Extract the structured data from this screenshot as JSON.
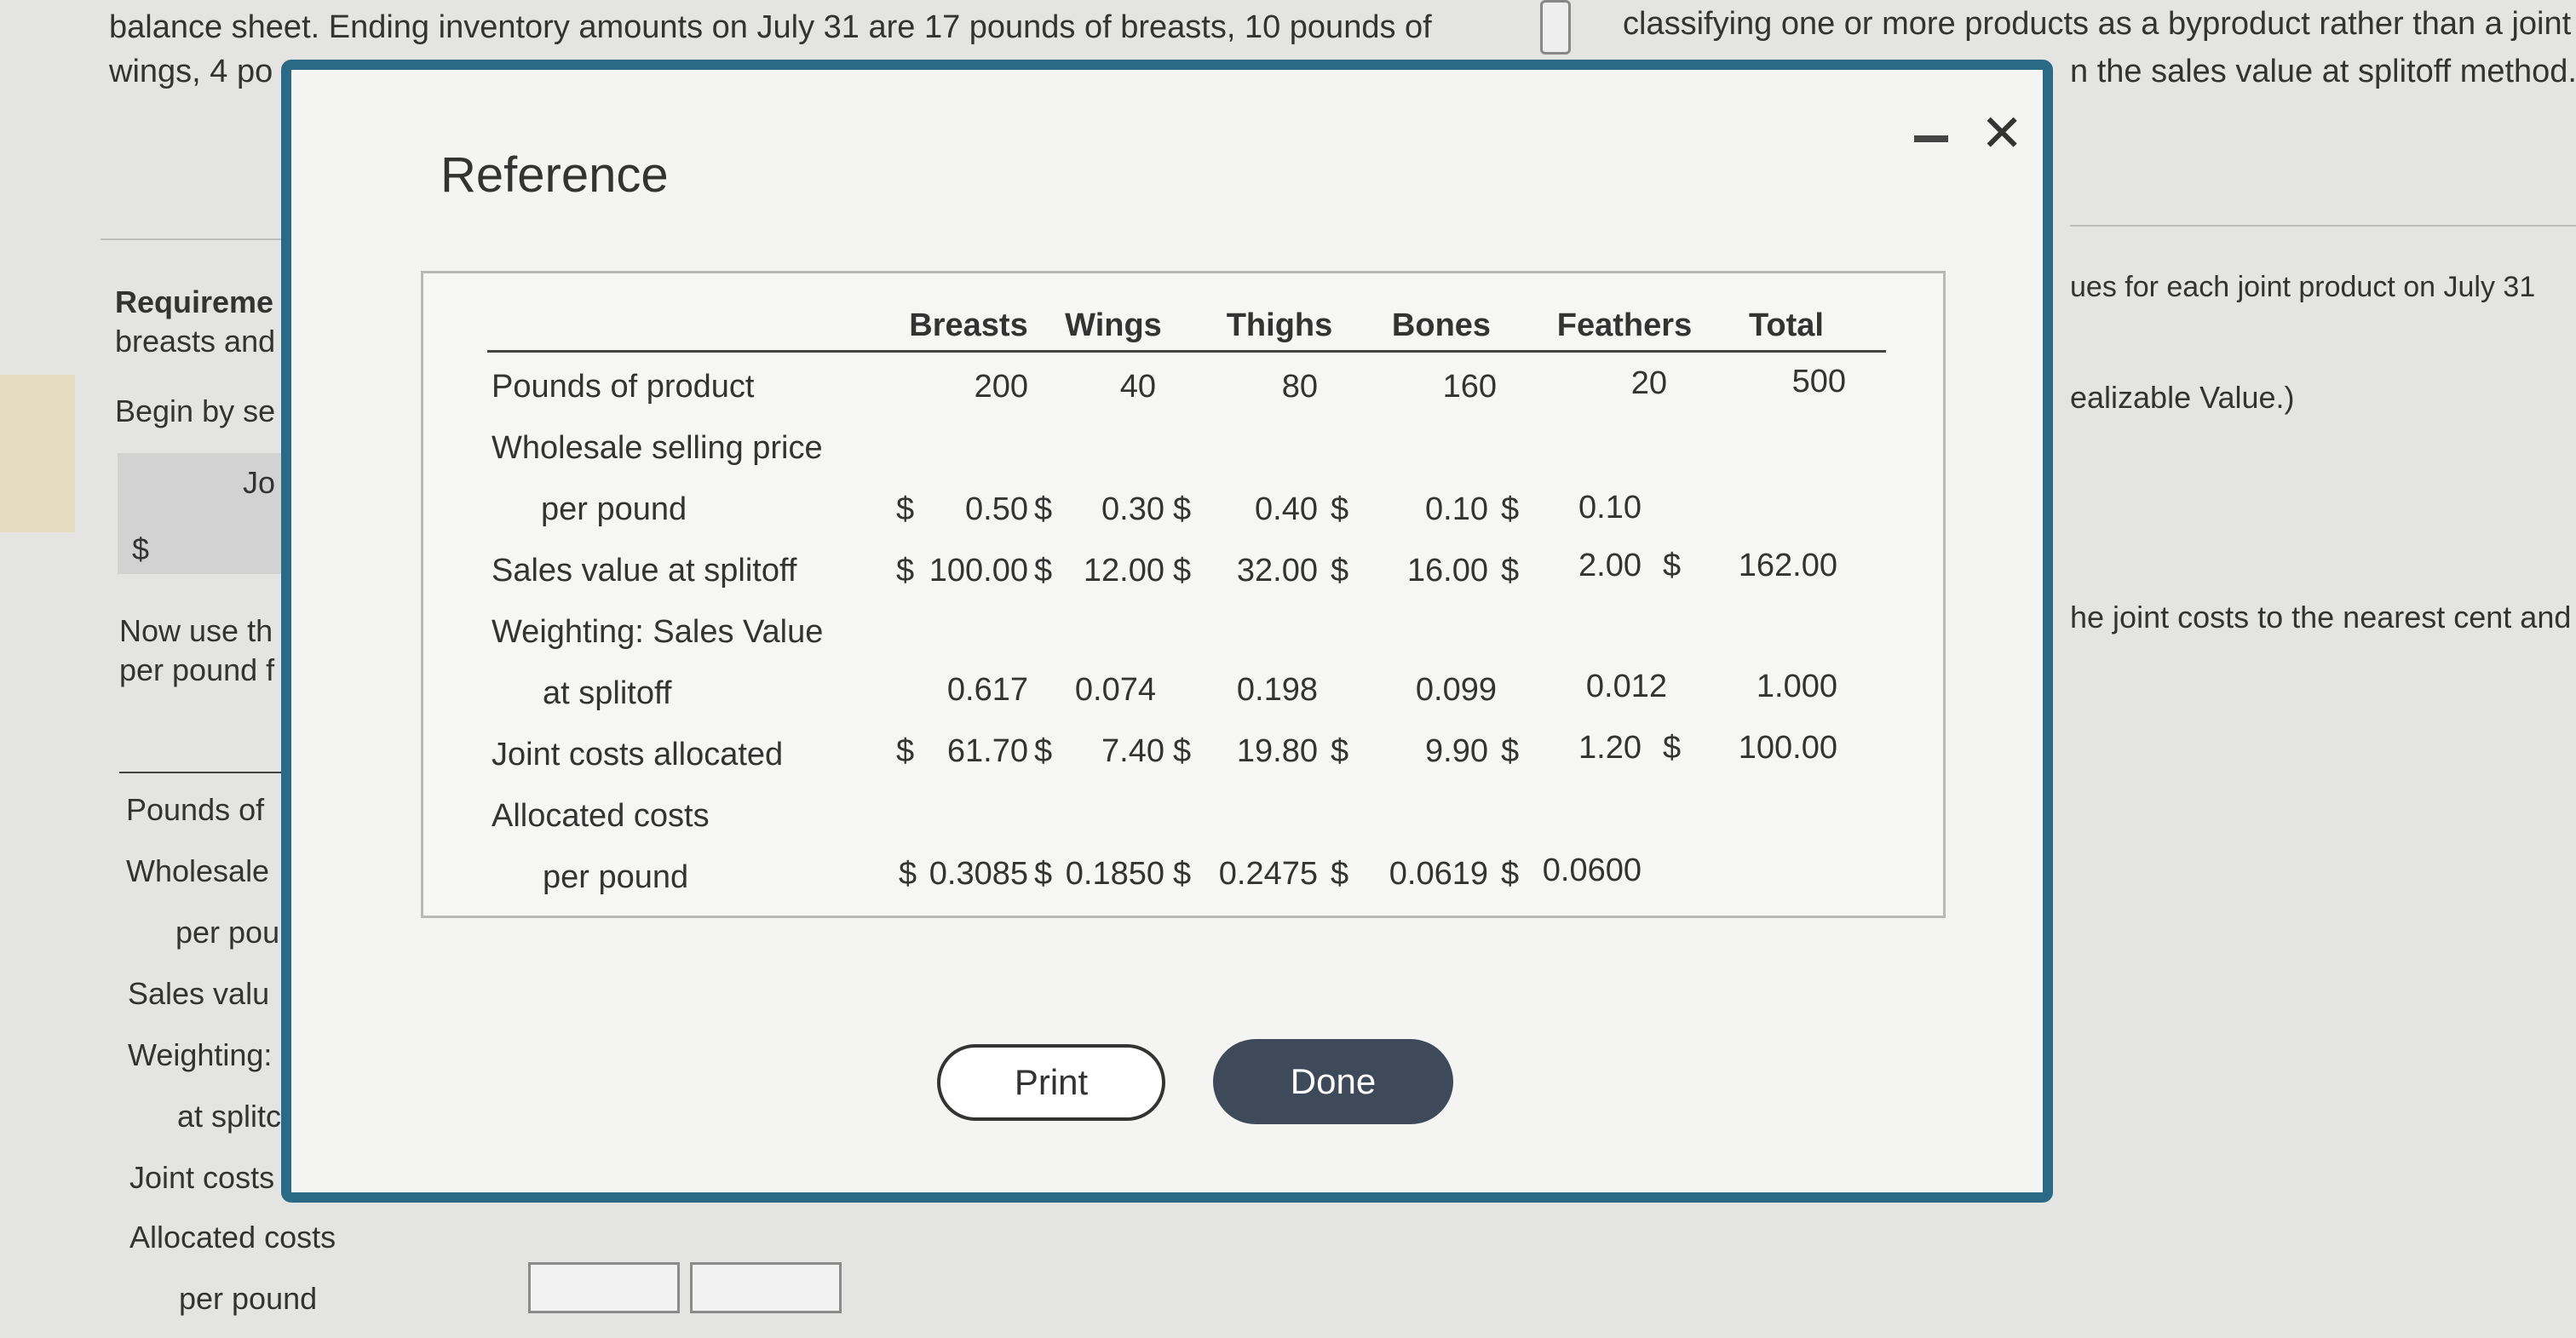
{
  "background": {
    "top_line1": "balance sheet. Ending inventory amounts on July 31 are 17 pounds of breasts, 10 pounds of",
    "top_line2": "wings, 4 po",
    "right_line1": "classifying one or more products as a byproduct rather than a joint pr",
    "right_line2": "n the sales value at splitoff method.)",
    "left_req1": "Requireme",
    "left_req2": "breasts and",
    "left_begin": "Begin by se",
    "left_jo": "Jo",
    "left_dollar": "$",
    "left_nowuse1": "Now use th",
    "left_nowuse2": "per pound f",
    "left_rows": [
      "Pounds of",
      "Wholesale",
      "per pou",
      "Sales valu",
      "Weighting:",
      "at splitc",
      "Joint costs",
      "Allocated costs",
      "per pound"
    ],
    "right_values1": "ues for each joint product on July 31",
    "right_values2": "ealizable Value.)",
    "right_values3": "he joint costs to the nearest cent and"
  },
  "modal": {
    "title": "Reference",
    "columns": [
      "Breasts",
      "Wings",
      "Thighs",
      "Bones",
      "Feathers",
      "Total"
    ],
    "labels": {
      "pounds": "Pounds of product",
      "wholesale": "Wholesale selling price",
      "per_pound": "per pound",
      "sales_value": "Sales value at splitoff",
      "weighting": "Weighting: Sales Value",
      "at_splitoff": "at splitoff",
      "joint_costs": "Joint costs allocated",
      "allocated_costs": "Allocated costs",
      "alloc_per_pound": "per pound"
    },
    "pounds": [
      "200",
      "40",
      "80",
      "160",
      "20",
      "500"
    ],
    "price_per_pound": [
      "0.50",
      "0.30",
      "0.40",
      "0.10",
      "0.10"
    ],
    "sales_value": [
      "100.00",
      "12.00",
      "32.00",
      "16.00",
      "2.00",
      "162.00"
    ],
    "weighting": [
      "0.617",
      "0.074",
      "0.198",
      "0.099",
      "0.012",
      "1.000"
    ],
    "joint_costs": [
      "61.70",
      "7.40",
      "19.80",
      "9.90",
      "1.20",
      "100.00"
    ],
    "alloc_per_pound": [
      "0.3085",
      "0.1850",
      "0.2475",
      "0.0619",
      "0.0600"
    ],
    "currency": "$",
    "print_label": "Print",
    "done_label": "Done"
  }
}
